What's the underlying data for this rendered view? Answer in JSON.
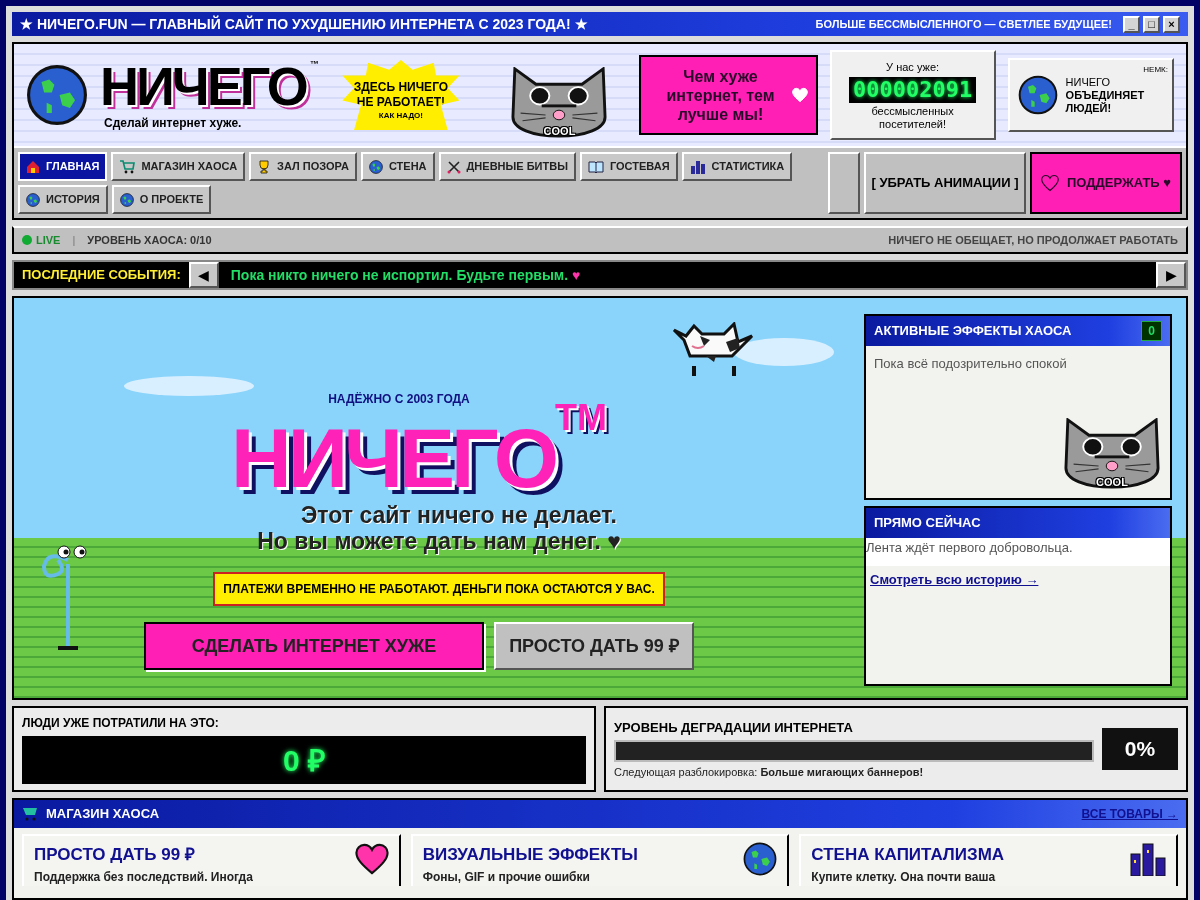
{
  "window": {
    "title": "★ НИЧЕГО.FUN — ГЛАВНЫЙ САЙТ ПО УХУДШЕНИЮ ИНТЕРНЕТА С 2023 ГОДА! ★",
    "slogan": "БОЛЬШЕ БЕССМЫСЛЕННОГО — СВЕТЛЕЕ БУДУЩЕЕ!",
    "controls": [
      "_",
      "□",
      "×"
    ]
  },
  "header": {
    "logo": "НИЧЕГО",
    "trademark": "™",
    "tagline": "Сделай интернет хуже.",
    "burst": [
      "ЗДЕСЬ НИЧЕГО",
      "НЕ РАБОТАЕТ!",
      "КАК НАДО!"
    ],
    "cat_label": "COOL",
    "promo": "Чем хуже интернет, тем лучше мы!",
    "counter": {
      "label": "У нас уже:",
      "value": "000002091",
      "caption": "бессмысленных посетителей!"
    },
    "ad": {
      "corner": "НЕМК:",
      "line1": "НИЧЕГО",
      "line2": "ОБЪЕДИНЯЕТ ЛЮДЕЙ!"
    }
  },
  "nav": {
    "items": [
      {
        "label": "ГЛАВНАЯ",
        "selected": true
      },
      {
        "label": "МАГАЗИН ХАОСА",
        "selected": false
      },
      {
        "label": "ЗАЛ ПОЗОРА",
        "selected": false
      },
      {
        "label": "СТЕНА",
        "selected": false
      },
      {
        "label": "ДНЕВНЫЕ БИТВЫ",
        "selected": false
      },
      {
        "label": "ГОСТЕВАЯ",
        "selected": false
      },
      {
        "label": "СТАТИСТИКА",
        "selected": false
      },
      {
        "label": "ИСТОРИЯ",
        "selected": false
      },
      {
        "label": "О ПРОЕКТЕ",
        "selected": false
      }
    ],
    "animations_button": "[ УБРАТЬ АНИМАЦИИ ]",
    "support_button": "ПОДДЕРЖАТЬ ♥"
  },
  "status_bar": {
    "live": "LIVE",
    "separator": "|",
    "chaos": "УРОВЕНЬ ХАОСА: 0/10",
    "motto": "НИЧЕГО НЕ ОБЕЩАЕТ, НО ПРОДОЛЖАЕТ РАБОТАТЬ"
  },
  "ticker": {
    "label": "ПОСЛЕДНИЕ СОБЫТИЯ:",
    "prev": "◀",
    "text": "Пока никто ничего не испортил. Будьте первым.",
    "heart": "♥",
    "next": "▶"
  },
  "hero": {
    "since": "НАДЁЖНО С 2003 ГОДА",
    "title": "НИЧЕГО",
    "tm": "TM",
    "lines": [
      "Этот сайт ничего не делает.",
      "Но вы можете дать нам денег. ♥"
    ],
    "notice": "ПЛАТЕЖИ ВРЕМЕННО НЕ РАБОТАЮТ. ДЕНЬГИ ПОКА ОСТАЮТСЯ У ВАС.",
    "buttons": [
      {
        "label": "СДЕЛАТЬ ИНТЕРНЕТ ХУЖЕ",
        "kind": "primary"
      },
      {
        "label": "ПРОСТО ДАТЬ 99 ₽",
        "kind": "secondary"
      }
    ],
    "cat_label": "COOL"
  },
  "effects_panel": {
    "title": "АКТИВНЫЕ ЭФФЕКТЫ ХАОСА",
    "badge": "0",
    "text": "Пока всё подозрительно спокой"
  },
  "now_panel": {
    "title": "ПРЯМО СЕЙЧАС",
    "text": "Лента ждёт первого добровольца.",
    "link": "Смотреть всю историю →"
  },
  "spent": {
    "label": "ЛЮДИ УЖЕ ПОТРАТИЛИ НА ЭТО:",
    "value": "0 ₽"
  },
  "degradation": {
    "title": "УРОВЕНЬ ДЕГРАДАЦИИ ИНТЕРНЕТА",
    "level": 0,
    "next": "Следующая разблокировка: **Больше мигающих баннеров!**",
    "percent": "0%"
  },
  "shop": {
    "title": "МАГАЗИН ХАОСА",
    "link": "ВСЕ ТОВАРЫ →",
    "items": [
      {
        "title": "ПРОСТО ДАТЬ 99 ₽",
        "text": "Поддержка без последствий. Иногда"
      },
      {
        "title": "ВИЗУАЛЬНЫЕ ЭФФЕКТЫ",
        "text": "Фоны, GIF и прочие ошибки"
      },
      {
        "title": "СТЕНА КАПИТАЛИЗМА",
        "text": "Купите клетку. Она почти ваша"
      }
    ]
  }
}
